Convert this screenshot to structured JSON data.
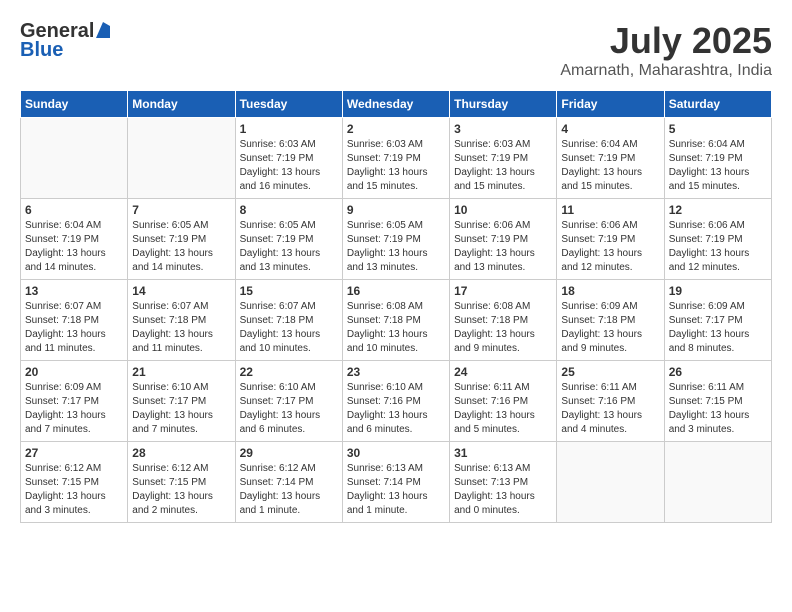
{
  "header": {
    "logo_general": "General",
    "logo_blue": "Blue",
    "month": "July 2025",
    "location": "Amarnath, Maharashtra, India"
  },
  "weekdays": [
    "Sunday",
    "Monday",
    "Tuesday",
    "Wednesday",
    "Thursday",
    "Friday",
    "Saturday"
  ],
  "weeks": [
    [
      {
        "day": "",
        "info": ""
      },
      {
        "day": "",
        "info": ""
      },
      {
        "day": "1",
        "info": "Sunrise: 6:03 AM\nSunset: 7:19 PM\nDaylight: 13 hours and 16 minutes."
      },
      {
        "day": "2",
        "info": "Sunrise: 6:03 AM\nSunset: 7:19 PM\nDaylight: 13 hours and 15 minutes."
      },
      {
        "day": "3",
        "info": "Sunrise: 6:03 AM\nSunset: 7:19 PM\nDaylight: 13 hours and 15 minutes."
      },
      {
        "day": "4",
        "info": "Sunrise: 6:04 AM\nSunset: 7:19 PM\nDaylight: 13 hours and 15 minutes."
      },
      {
        "day": "5",
        "info": "Sunrise: 6:04 AM\nSunset: 7:19 PM\nDaylight: 13 hours and 15 minutes."
      }
    ],
    [
      {
        "day": "6",
        "info": "Sunrise: 6:04 AM\nSunset: 7:19 PM\nDaylight: 13 hours and 14 minutes."
      },
      {
        "day": "7",
        "info": "Sunrise: 6:05 AM\nSunset: 7:19 PM\nDaylight: 13 hours and 14 minutes."
      },
      {
        "day": "8",
        "info": "Sunrise: 6:05 AM\nSunset: 7:19 PM\nDaylight: 13 hours and 13 minutes."
      },
      {
        "day": "9",
        "info": "Sunrise: 6:05 AM\nSunset: 7:19 PM\nDaylight: 13 hours and 13 minutes."
      },
      {
        "day": "10",
        "info": "Sunrise: 6:06 AM\nSunset: 7:19 PM\nDaylight: 13 hours and 13 minutes."
      },
      {
        "day": "11",
        "info": "Sunrise: 6:06 AM\nSunset: 7:19 PM\nDaylight: 13 hours and 12 minutes."
      },
      {
        "day": "12",
        "info": "Sunrise: 6:06 AM\nSunset: 7:19 PM\nDaylight: 13 hours and 12 minutes."
      }
    ],
    [
      {
        "day": "13",
        "info": "Sunrise: 6:07 AM\nSunset: 7:18 PM\nDaylight: 13 hours and 11 minutes."
      },
      {
        "day": "14",
        "info": "Sunrise: 6:07 AM\nSunset: 7:18 PM\nDaylight: 13 hours and 11 minutes."
      },
      {
        "day": "15",
        "info": "Sunrise: 6:07 AM\nSunset: 7:18 PM\nDaylight: 13 hours and 10 minutes."
      },
      {
        "day": "16",
        "info": "Sunrise: 6:08 AM\nSunset: 7:18 PM\nDaylight: 13 hours and 10 minutes."
      },
      {
        "day": "17",
        "info": "Sunrise: 6:08 AM\nSunset: 7:18 PM\nDaylight: 13 hours and 9 minutes."
      },
      {
        "day": "18",
        "info": "Sunrise: 6:09 AM\nSunset: 7:18 PM\nDaylight: 13 hours and 9 minutes."
      },
      {
        "day": "19",
        "info": "Sunrise: 6:09 AM\nSunset: 7:17 PM\nDaylight: 13 hours and 8 minutes."
      }
    ],
    [
      {
        "day": "20",
        "info": "Sunrise: 6:09 AM\nSunset: 7:17 PM\nDaylight: 13 hours and 7 minutes."
      },
      {
        "day": "21",
        "info": "Sunrise: 6:10 AM\nSunset: 7:17 PM\nDaylight: 13 hours and 7 minutes."
      },
      {
        "day": "22",
        "info": "Sunrise: 6:10 AM\nSunset: 7:17 PM\nDaylight: 13 hours and 6 minutes."
      },
      {
        "day": "23",
        "info": "Sunrise: 6:10 AM\nSunset: 7:16 PM\nDaylight: 13 hours and 6 minutes."
      },
      {
        "day": "24",
        "info": "Sunrise: 6:11 AM\nSunset: 7:16 PM\nDaylight: 13 hours and 5 minutes."
      },
      {
        "day": "25",
        "info": "Sunrise: 6:11 AM\nSunset: 7:16 PM\nDaylight: 13 hours and 4 minutes."
      },
      {
        "day": "26",
        "info": "Sunrise: 6:11 AM\nSunset: 7:15 PM\nDaylight: 13 hours and 3 minutes."
      }
    ],
    [
      {
        "day": "27",
        "info": "Sunrise: 6:12 AM\nSunset: 7:15 PM\nDaylight: 13 hours and 3 minutes."
      },
      {
        "day": "28",
        "info": "Sunrise: 6:12 AM\nSunset: 7:15 PM\nDaylight: 13 hours and 2 minutes."
      },
      {
        "day": "29",
        "info": "Sunrise: 6:12 AM\nSunset: 7:14 PM\nDaylight: 13 hours and 1 minute."
      },
      {
        "day": "30",
        "info": "Sunrise: 6:13 AM\nSunset: 7:14 PM\nDaylight: 13 hours and 1 minute."
      },
      {
        "day": "31",
        "info": "Sunrise: 6:13 AM\nSunset: 7:13 PM\nDaylight: 13 hours and 0 minutes."
      },
      {
        "day": "",
        "info": ""
      },
      {
        "day": "",
        "info": ""
      }
    ]
  ]
}
